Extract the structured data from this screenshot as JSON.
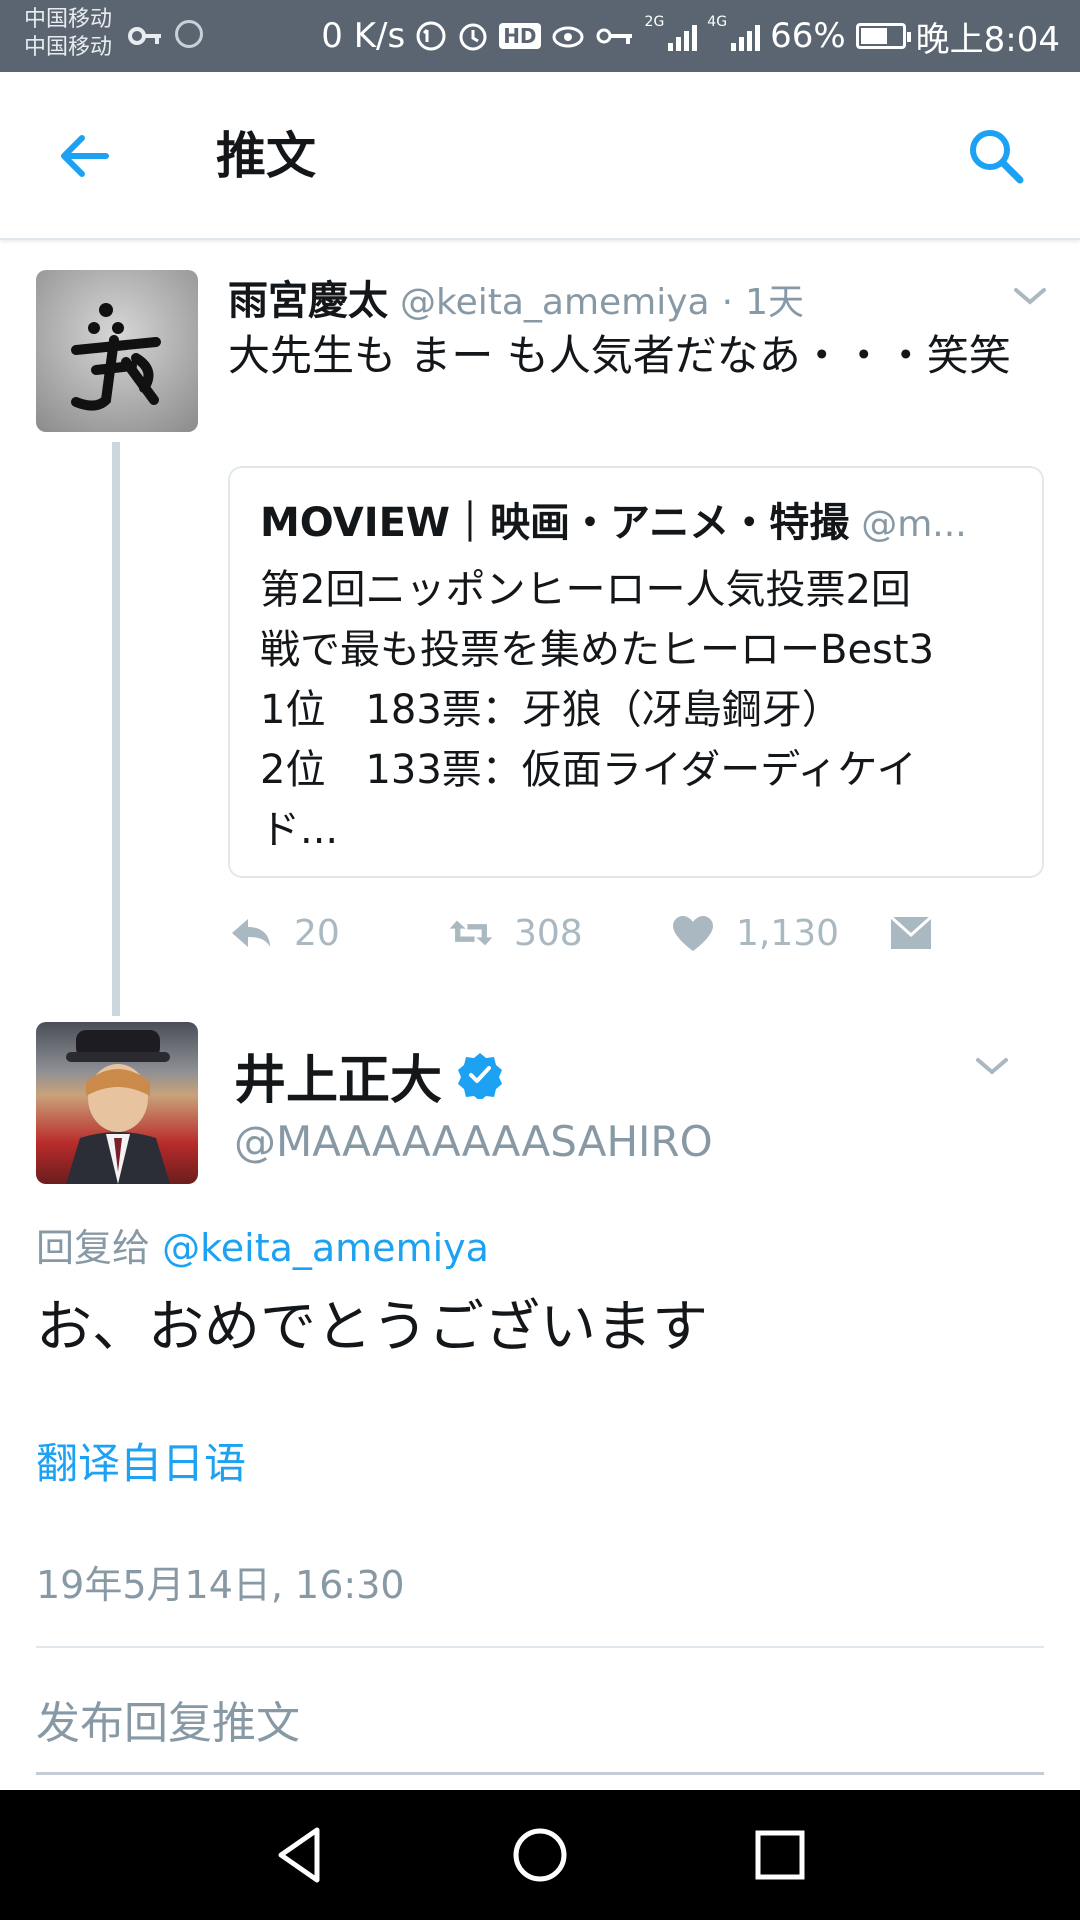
{
  "statusbar": {
    "carrier1": "中国移动",
    "carrier2": "中国移动",
    "net_speed": "0 K/s",
    "hd_badge": "HD",
    "sig1_label": "2G",
    "sig2_label": "4G",
    "battery": "66%",
    "time": "晚上8:04",
    "battery_level": 0.66
  },
  "appbar": {
    "title": "推文",
    "back_icon": "arrow-left-icon",
    "search_icon": "search-icon",
    "accent": "#1da1f2"
  },
  "tweet1": {
    "author_name": "雨宮慶太",
    "handle": "@keita_amemiya",
    "dot": "·",
    "time": "1天",
    "text": "大先生も まー も人気者だなあ・・・笑笑",
    "quote": {
      "name": "MOVIEW｜映画・アニメ・特撮",
      "handle": "@m...",
      "lines": [
        "第2回ニッポンヒーロー人気投票2回",
        "戦で最も投票を集めたヒーローBest3",
        "1位　183票：牙狼（冴島鋼牙）",
        "2位　133票：仮面ライダーディケイ",
        "ド..."
      ]
    },
    "actions": {
      "reply_count": "20",
      "retweet_count": "308",
      "like_count": "1,130"
    }
  },
  "tweet2": {
    "author_name": "井上正大",
    "handle": "@MAAAAAAAASAHIRO",
    "reply_label": "回复给",
    "reply_mention": "@keita_amemiya",
    "text": "お、おめでとうございます",
    "translate_link": "翻译自日语",
    "date": "19年5月14日, 16:30"
  },
  "compose": {
    "placeholder": "发布回复推文"
  },
  "colors": {
    "accent": "#1da1f2",
    "secondary_text": "#8899a6",
    "action_gray": "#aab8c2"
  }
}
